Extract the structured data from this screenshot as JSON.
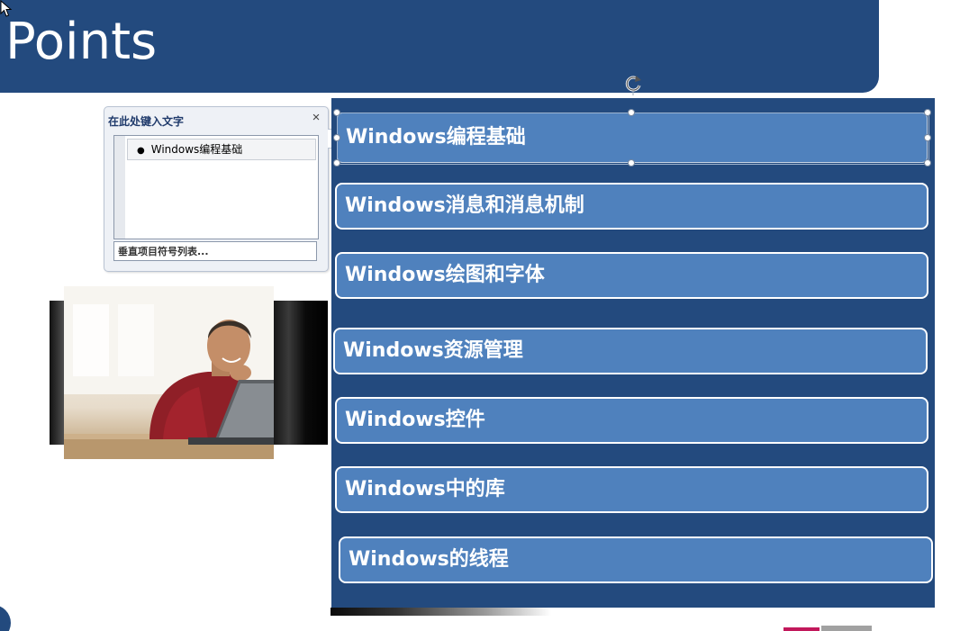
{
  "slide": {
    "title": "Points"
  },
  "text_pane": {
    "title": "在此处键入文字",
    "close_glyph": "×",
    "expander_glyph": "›",
    "items": [
      {
        "label": "Windows编程基础"
      }
    ],
    "footer_label": "垂直项目符号列表..."
  },
  "smartart": {
    "items": [
      {
        "label": "Windows编程基础",
        "selected": true
      },
      {
        "label": "Windows消息和消息机制"
      },
      {
        "label": "Windows绘图和字体"
      },
      {
        "label": "Windows资源管理"
      },
      {
        "label": "Windows控件"
      },
      {
        "label": "Windows中的库"
      },
      {
        "label": "Windows的线程"
      }
    ]
  },
  "icons": {
    "cursor": "arrow-cursor-icon",
    "rotate": "rotate-handle-icon",
    "close": "close-icon",
    "expand": "chevron-right-icon",
    "bullet": "bullet-icon"
  },
  "colors": {
    "banner": "#234a7e",
    "item_fill": "#4f81bd",
    "item_border": "#ffffff",
    "pane_title": "#1f3a6b"
  }
}
